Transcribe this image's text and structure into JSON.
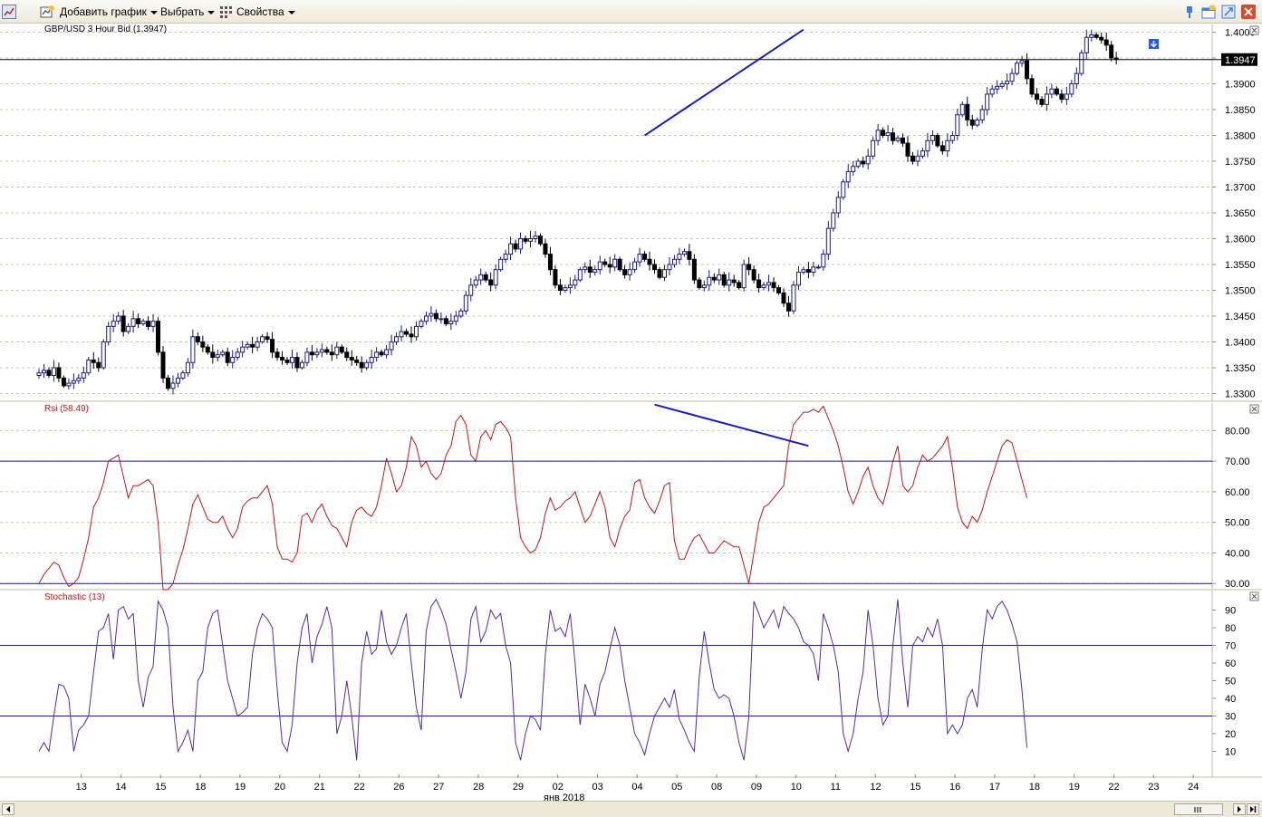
{
  "toolbar": {
    "add_chart": "Добавить график",
    "select": "Выбрать",
    "properties": "Свойства"
  },
  "colors": {
    "candle_up_border": "#1a1a80",
    "candle_down": "#000000",
    "trendline": "#1c1cb0",
    "rsi_line": "#c01818",
    "stoch_line": "#5a2aa0",
    "level_line": "#1c1c90",
    "grid": "#c8c8b4",
    "axis_text": "#000000"
  },
  "chart_data": [
    {
      "type": "candlestick",
      "title": "GBP/USD 3 Hour Bid (1.3947)",
      "last_price": "1.3947",
      "ylim": [
        1.3285,
        1.4015
      ],
      "ytick_labels": [
        "1.4000",
        "1.3950",
        "1.3900",
        "1.3850",
        "1.3800",
        "1.3750",
        "1.3700",
        "1.3650",
        "1.3600",
        "1.3550",
        "1.3500",
        "1.3450",
        "1.3400",
        "1.3350",
        "1.3300"
      ],
      "ytick_values": [
        1.4,
        1.395,
        1.39,
        1.385,
        1.38,
        1.375,
        1.37,
        1.365,
        1.36,
        1.355,
        1.35,
        1.345,
        1.34,
        1.335,
        1.33
      ],
      "bars_per_day": 8,
      "day_labels": [
        "13",
        "14",
        "15",
        "18",
        "19",
        "20",
        "21",
        "22",
        "26",
        "27",
        "28",
        "29",
        "02",
        "03",
        "04",
        "05",
        "08",
        "09",
        "10",
        "11",
        "12",
        "15",
        "16",
        "17",
        "18",
        "19",
        "22",
        "23",
        "24"
      ],
      "month_label": "янв 2018",
      "closes": [
        1.334,
        1.3345,
        1.3335,
        1.335,
        1.333,
        1.3315,
        1.332,
        1.3325,
        1.333,
        1.334,
        1.3365,
        1.336,
        1.335,
        1.34,
        1.343,
        1.344,
        1.345,
        1.342,
        1.343,
        1.3445,
        1.3435,
        1.344,
        1.343,
        1.344,
        1.338,
        1.333,
        1.331,
        1.332,
        1.333,
        1.334,
        1.336,
        1.341,
        1.34,
        1.339,
        1.338,
        1.337,
        1.3375,
        1.338,
        1.336,
        1.337,
        1.338,
        1.339,
        1.3395,
        1.339,
        1.34,
        1.341,
        1.3405,
        1.338,
        1.337,
        1.3365,
        1.336,
        1.337,
        1.335,
        1.336,
        1.338,
        1.3375,
        1.338,
        1.3385,
        1.338,
        1.3375,
        1.339,
        1.338,
        1.337,
        1.3365,
        1.336,
        1.335,
        1.336,
        1.337,
        1.338,
        1.3375,
        1.3385,
        1.34,
        1.341,
        1.342,
        1.3415,
        1.341,
        1.343,
        1.344,
        1.345,
        1.3455,
        1.3445,
        1.3445,
        1.3435,
        1.344,
        1.345,
        1.346,
        1.349,
        1.351,
        1.352,
        1.353,
        1.352,
        1.351,
        1.354,
        1.356,
        1.357,
        1.359,
        1.358,
        1.36,
        1.3595,
        1.36,
        1.3605,
        1.359,
        1.357,
        1.354,
        1.351,
        1.35,
        1.3505,
        1.351,
        1.352,
        1.354,
        1.3545,
        1.3535,
        1.354,
        1.3555,
        1.355,
        1.3545,
        1.356,
        1.354,
        1.353,
        1.354,
        1.3555,
        1.357,
        1.356,
        1.355,
        1.354,
        1.3525,
        1.354,
        1.355,
        1.356,
        1.357,
        1.3575,
        1.356,
        1.352,
        1.3505,
        1.351,
        1.3525,
        1.352,
        1.353,
        1.351,
        1.352,
        1.3515,
        1.3505,
        1.355,
        1.354,
        1.352,
        1.3505,
        1.351,
        1.3515,
        1.3505,
        1.3495,
        1.3475,
        1.346,
        1.351,
        1.3535,
        1.354,
        1.3535,
        1.3545,
        1.3545,
        1.357,
        1.362,
        1.365,
        1.368,
        1.371,
        1.373,
        1.374,
        1.375,
        1.3745,
        1.376,
        1.379,
        1.381,
        1.38,
        1.3805,
        1.379,
        1.3795,
        1.3785,
        1.376,
        1.375,
        1.376,
        1.377,
        1.379,
        1.38,
        1.378,
        1.377,
        1.379,
        1.38,
        1.384,
        1.386,
        1.383,
        1.382,
        1.383,
        1.385,
        1.388,
        1.389,
        1.3895,
        1.39,
        1.3905,
        1.392,
        1.394,
        1.3945,
        1.391,
        1.388,
        1.387,
        1.386,
        1.388,
        1.389,
        1.388,
        1.387,
        1.388,
        1.39,
        1.392,
        1.396,
        1.399,
        1.3995,
        1.399,
        1.3985,
        1.3975,
        1.395,
        1.3947
      ],
      "trendline": {
        "x_bar": [
          122,
          154
        ],
        "y_value": [
          1.38,
          1.4005
        ]
      }
    },
    {
      "type": "line",
      "title": "Rsi (58.49)",
      "ylim": [
        28,
        89
      ],
      "ytick_labels": [
        "80.00",
        "70.00",
        "60.00",
        "50.00",
        "40.00",
        "30.00"
      ],
      "ytick_values": [
        80,
        70,
        60,
        50,
        40,
        30
      ],
      "levels": [
        70,
        30
      ],
      "values": [
        30,
        33,
        35,
        37,
        36,
        32,
        29,
        30,
        32,
        38,
        45,
        55,
        58,
        63,
        70,
        71,
        72,
        65,
        58,
        62,
        62,
        63,
        64,
        62,
        50,
        28,
        28,
        30,
        36,
        41,
        48,
        56,
        59,
        55,
        51,
        50,
        50,
        52,
        48,
        45,
        48,
        55,
        57,
        58,
        58,
        60,
        62,
        56,
        42,
        38,
        38,
        37,
        40,
        52,
        53,
        50,
        54,
        56,
        52,
        49,
        48,
        45,
        42,
        50,
        54,
        55,
        53,
        52,
        55,
        62,
        71,
        66,
        60,
        62,
        68,
        78,
        75,
        68,
        70,
        66,
        64,
        66,
        72,
        75,
        83,
        85,
        82,
        72,
        70,
        78,
        80,
        77,
        82,
        83,
        81,
        78,
        58,
        45,
        42,
        40,
        41,
        45,
        53,
        58,
        54,
        55,
        57,
        58,
        60,
        55,
        50,
        52,
        56,
        60,
        55,
        45,
        42,
        48,
        52,
        54,
        63,
        64,
        58,
        55,
        53,
        57,
        62,
        63,
        44,
        38,
        38,
        42,
        45,
        46,
        43,
        40,
        40,
        42,
        44,
        43,
        42,
        42,
        36,
        30,
        40,
        50,
        55,
        56,
        58,
        60,
        62,
        75,
        82,
        84,
        86,
        86,
        87,
        86,
        88,
        84,
        80,
        75,
        68,
        60,
        56,
        60,
        65,
        68,
        62,
        58,
        56,
        62,
        70,
        75,
        62,
        60,
        62,
        68,
        72,
        70,
        71,
        73,
        75,
        78,
        68,
        55,
        50,
        48,
        52,
        50,
        54,
        60,
        65,
        70,
        75,
        77,
        76,
        70,
        64,
        58
      ],
      "trendline": {
        "x_bar": [
          124,
          155
        ],
        "y_value": [
          88.5,
          75.0
        ]
      }
    },
    {
      "type": "line",
      "title": "Stochastic (13)",
      "ylim": [
        0,
        100
      ],
      "ytick_labels": [
        "90",
        "80",
        "70",
        "60",
        "50",
        "40",
        "30",
        "20",
        "10"
      ],
      "ytick_values": [
        90,
        80,
        70,
        60,
        50,
        40,
        30,
        20,
        10
      ],
      "levels": [
        70,
        30
      ],
      "values": [
        10,
        15,
        10,
        30,
        48,
        47,
        40,
        10,
        22,
        25,
        30,
        55,
        78,
        80,
        88,
        62,
        90,
        92,
        85,
        88,
        50,
        35,
        52,
        58,
        95,
        90,
        80,
        35,
        10,
        15,
        22,
        10,
        50,
        55,
        80,
        88,
        90,
        70,
        50,
        40,
        30,
        32,
        35,
        65,
        80,
        88,
        85,
        80,
        45,
        15,
        10,
        25,
        60,
        80,
        88,
        60,
        75,
        82,
        92,
        80,
        20,
        30,
        50,
        30,
        5,
        60,
        78,
        65,
        68,
        90,
        72,
        65,
        70,
        80,
        88,
        60,
        35,
        22,
        78,
        92,
        96,
        90,
        82,
        68,
        55,
        40,
        55,
        85,
        92,
        72,
        78,
        90,
        85,
        88,
        70,
        60,
        15,
        5,
        20,
        30,
        28,
        22,
        65,
        90,
        78,
        80,
        75,
        88,
        60,
        25,
        48,
        40,
        30,
        48,
        55,
        68,
        80,
        70,
        50,
        35,
        20,
        15,
        8,
        20,
        30,
        35,
        40,
        35,
        45,
        28,
        22,
        15,
        10,
        52,
        78,
        60,
        45,
        40,
        42,
        40,
        30,
        15,
        5,
        30,
        95,
        88,
        80,
        85,
        90,
        80,
        92,
        88,
        85,
        80,
        72,
        70,
        65,
        50,
        88,
        80,
        70,
        55,
        20,
        10,
        20,
        40,
        55,
        90,
        70,
        40,
        25,
        30,
        70,
        96,
        60,
        35,
        70,
        75,
        72,
        80,
        75,
        85,
        70,
        20,
        25,
        20,
        25,
        40,
        45,
        35,
        68,
        90,
        85,
        92,
        95,
        90,
        82,
        72,
        45,
        12
      ]
    }
  ]
}
